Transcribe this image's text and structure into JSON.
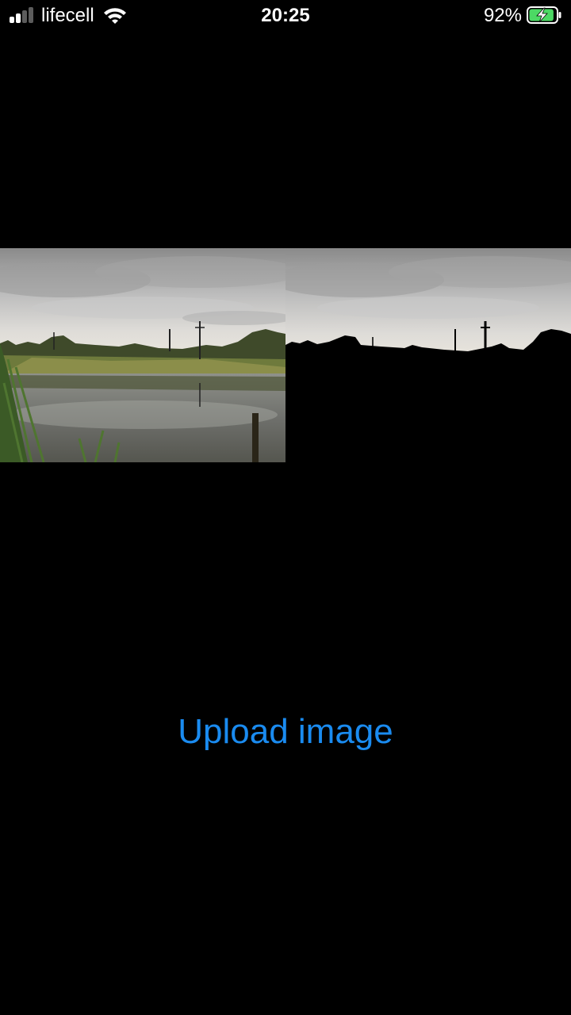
{
  "status_bar": {
    "carrier": "lifecell",
    "time": "20:25",
    "battery_percent": "92%",
    "battery_level": 0.92,
    "battery_charging": true,
    "signal_bars_active": 2,
    "signal_bars_total": 4,
    "icons": [
      "signal-icon",
      "wifi-icon",
      "battery-charging-icon"
    ]
  },
  "images": {
    "original": {
      "description_icon": "lake-landscape-photo"
    },
    "segmented": {
      "description_icon": "sky-segmentation-mask"
    }
  },
  "upload": {
    "label": "Upload image"
  },
  "colors": {
    "background": "#000000",
    "accent": "#1a8bf0",
    "battery_fill": "#4cd964",
    "text": "#ffffff"
  }
}
